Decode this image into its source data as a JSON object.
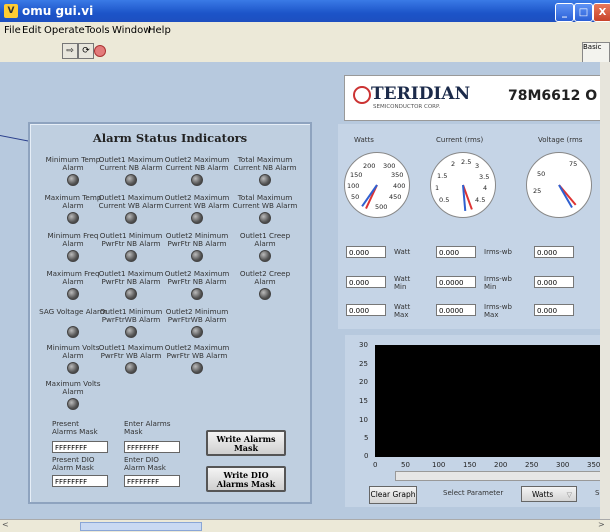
{
  "window": {
    "title": "omu gui.vi",
    "controls": [
      "_",
      "□",
      "X"
    ]
  },
  "menu": [
    "File",
    "Edit",
    "Operate",
    "Tools",
    "Window",
    "Help"
  ],
  "toolbar_icons": [
    "run-arrow",
    "run-continuous",
    "stop"
  ],
  "corner_label": "Basic",
  "panel": {
    "title": "Alarm Status Indicators",
    "alarms": [
      [
        "Minimum Temp Alarm",
        "Outlet1 Maximum Current NB Alarm",
        "Outlet2 Maximum Current NB Alarm",
        "Total Maximum Current NB Alarm"
      ],
      [
        "Maximum Temp Alarm",
        "Outlet1 Maximum Current WB Alarm",
        "Outlet2 Maximum Current WB Alarm",
        "Total Maximum Current WB Alarm"
      ],
      [
        "Minimum Freq Alarm",
        "Outlet1 Minimum PwrFtr NB Alarm",
        "Outlet2 Minimum PwrFtr NB Alarm",
        "Outlet1 Creep Alarm"
      ],
      [
        "Maximum Freq Alarm",
        "Outlet1 Maximum PwrFtr NB Alarm",
        "Outlet2 Maximum PwrFtr NB Alarm",
        "Outlet2 Creep Alarm"
      ],
      [
        "SAG Voltage Alarm",
        "Outlet1 Minimum PwrFtrWB Alarm",
        "Outlet2 Minimum PwrFtrWB Alarm",
        ""
      ],
      [
        "Minimum Volts Alarm",
        "Outlet1 Maximum PwrFtr WB Alarm",
        "Outlet2 Maximum PwrFtr WB Alarm",
        ""
      ],
      [
        "Maximum Volts Alarm",
        "",
        "",
        ""
      ]
    ],
    "present_alarms_mask_label": "Present Alarms Mask",
    "present_alarms_mask_value": "FFFFFFFF",
    "enter_alarms_mask_label": "Enter Alarms Mask",
    "enter_alarms_mask_value": "FFFFFFFF",
    "present_dio_mask_label": "Present DIO Alarm Mask",
    "present_dio_mask_value": "FFFFFFFF",
    "enter_dio_mask_label": "Enter DIO Alarm Mask",
    "enter_dio_mask_value": "FFFFFFFF",
    "write_alarms_button": "Write Alarms Mask",
    "write_dio_button": "Write DIO Alarms Mask"
  },
  "header": {
    "brand": "TERIDIAN",
    "brand_sub": "SEMICONDUCTOR CORP.",
    "model": "78M6612 O"
  },
  "meters": {
    "titles": [
      "Watts",
      "Current (rms)",
      "Voltage (rms"
    ],
    "watts_ticks": [
      "200",
      "300",
      "150",
      "350",
      "100",
      "400",
      "50",
      "450",
      "500"
    ],
    "current_ticks": [
      "2",
      "2.5",
      "3",
      "1.5",
      "3.5",
      "1",
      "4",
      "0.5",
      "4.5"
    ],
    "voltage_ticks": [
      "75",
      "50",
      "25"
    ],
    "rows": [
      {
        "v1": "0.000",
        "u1": "Watt",
        "v2": "0.000",
        "u2": "Irms-wb",
        "v3": "0.000"
      },
      {
        "v1": "0.000",
        "u1": "Watt Min",
        "v2": "0.0000",
        "u2": "Irms-wb Min",
        "v3": "0.000"
      },
      {
        "v1": "0.000",
        "u1": "Watt Max",
        "v2": "0.0000",
        "u2": "Irms-wb Max",
        "v3": "0.000"
      }
    ]
  },
  "graph": {
    "y_ticks": [
      "30",
      "25",
      "20",
      "15",
      "10",
      "5",
      "0"
    ],
    "x_ticks": [
      "0",
      "50",
      "100",
      "150",
      "200",
      "250",
      "300",
      "350"
    ],
    "clear_button": "Clear Graph",
    "select_label": "Select Parameter",
    "select_value": "Watts",
    "trailing_label": "Se"
  }
}
